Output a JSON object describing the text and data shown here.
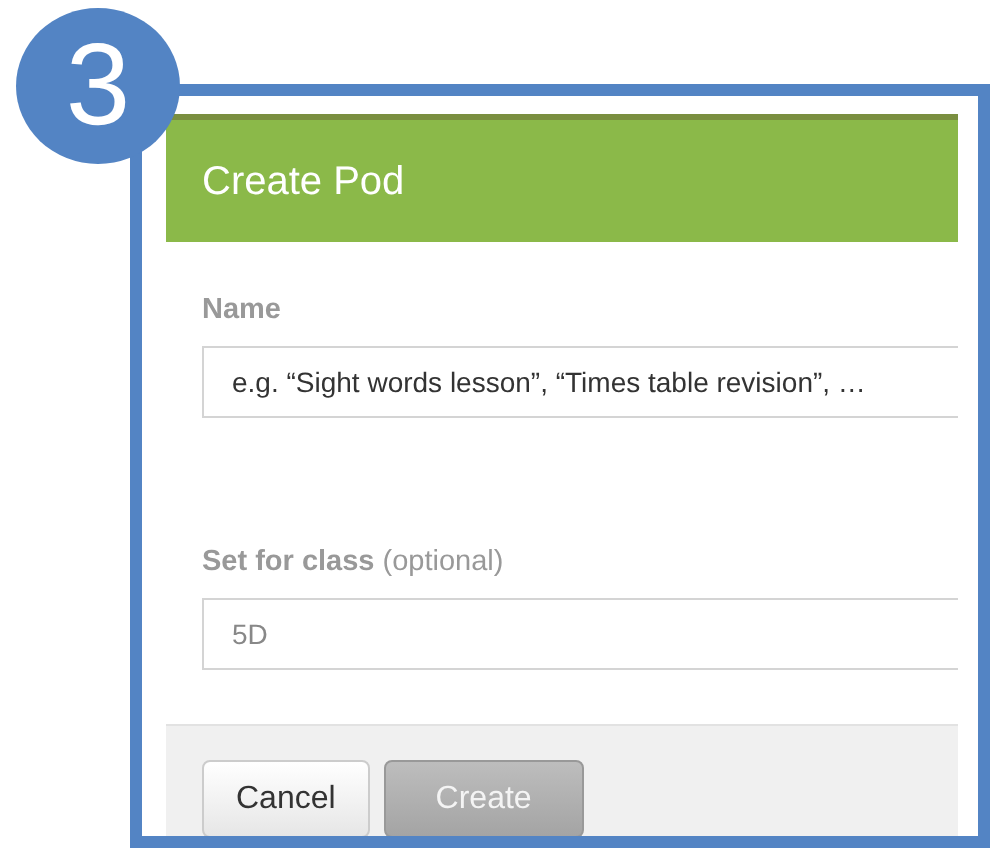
{
  "step": {
    "number": "3"
  },
  "dialog": {
    "title": "Create Pod",
    "fields": [
      {
        "label": "Name",
        "placeholder": "e.g. “Sight words lesson”, “Times table revision”, …"
      },
      {
        "label": "Set for class",
        "note": "(optional)",
        "placeholder": "5D"
      }
    ],
    "buttons": [
      {
        "label": "Cancel",
        "kind": "secondary",
        "disabled": false
      },
      {
        "label": "Create",
        "kind": "primary",
        "disabled": true
      }
    ]
  }
}
